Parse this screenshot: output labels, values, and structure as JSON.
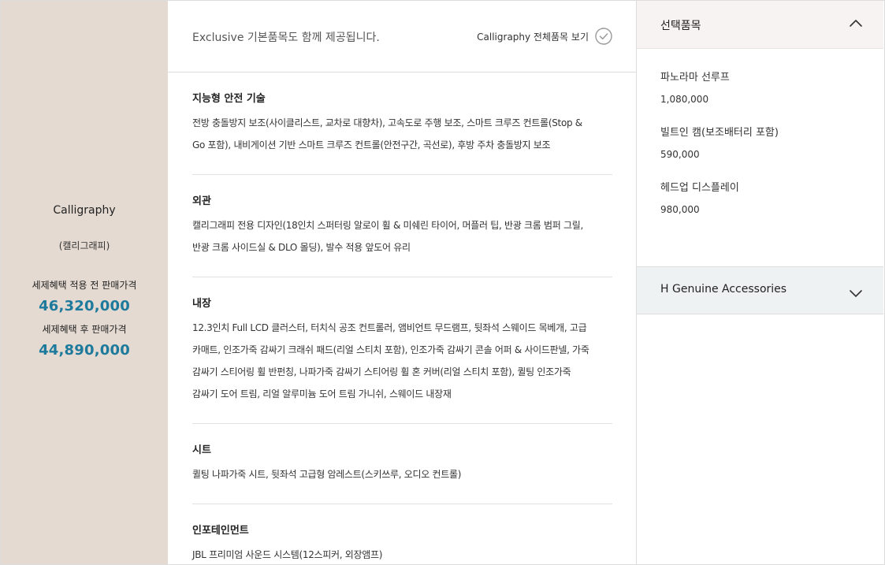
{
  "trim": {
    "name": "Calligraphy",
    "subtitle": "(캘리그래피)",
    "price_before_label": "세제혜택 적용 전 판매가격",
    "price_before": "46,320,000",
    "price_after_label": "세제혜택 후 판매가격",
    "price_after": "44,890,000"
  },
  "content": {
    "notice": "Exclusive 기본품목도 함께 제공됩니다.",
    "view_all_label": "Calligraphy 전체품목 보기",
    "sections": [
      {
        "title": "지능형 안전 기술",
        "lines": [
          "전방 충돌방지 보조(사이클리스트, 교차로 대향차), 고속도로 주행 보조, 스마트 크루즈 컨트롤(Stop &",
          "Go 포함), 내비게이션 기반 스마트 크루즈 컨트롤(안전구간, 곡선로), 후방 주차 충돌방지 보조"
        ]
      },
      {
        "title": "외관",
        "lines": [
          "캘리그래피 전용 디자인(18인치 스퍼터링 알로이 휠 & 미쉐린 타이어, 머플러 팁, 반광 크롬 범퍼 그릴,",
          "반광 크롬 사이드실 & DLO 몰딩), 발수 적용 앞도어 유리"
        ]
      },
      {
        "title": "내장",
        "lines": [
          "12.3인치 Full LCD 클러스터, 터치식 공조 컨트롤러, 앰비언트 무드램프, 뒷좌석 스웨이드 목베개, 고급",
          "카매트, 인조가죽 감싸기 크래쉬 패드(리얼 스티치 포함), 인조가죽 감싸기 콘솔 어퍼 & 사이드판넬, 가죽",
          "감싸기 스티어링 휠 반펀칭, 나파가죽 감싸기 스티어링 휠 혼 커버(리얼 스티치 포함), 퀼팅 인조가죽",
          "감싸기 도어 트림, 리얼 알루미늄 도어 트림 가니쉬, 스웨이드 내장재"
        ]
      },
      {
        "title": "시트",
        "lines": [
          "퀼팅 나파가죽 시트, 뒷좌석 고급형 암레스트(스키쓰루, 오디오 컨트롤)"
        ]
      },
      {
        "title": "인포테인먼트",
        "lines": [
          "JBL 프리미엄 사운드 시스템(12스피커, 외장앰프)"
        ]
      }
    ]
  },
  "options": {
    "header_label": "선택품목",
    "items": [
      {
        "name": "파노라마 선루프",
        "price": "1,080,000"
      },
      {
        "name": "빌트인 캠(보조배터리 포함)",
        "price": "590,000"
      },
      {
        "name": "헤드업 디스플레이",
        "price": "980,000"
      }
    ],
    "accessories_label": "H Genuine Accessories"
  },
  "icons": {
    "view_all": "check-circle-icon",
    "options_toggle": "chevron-up-icon",
    "accessories_toggle": "chevron-down-icon"
  },
  "colors": {
    "left_panel_bg": "#e4dad1",
    "price_accent": "#1d7a9c",
    "options_header_bg": "#f6f3f2",
    "accessories_bg": "#eff2f3"
  }
}
